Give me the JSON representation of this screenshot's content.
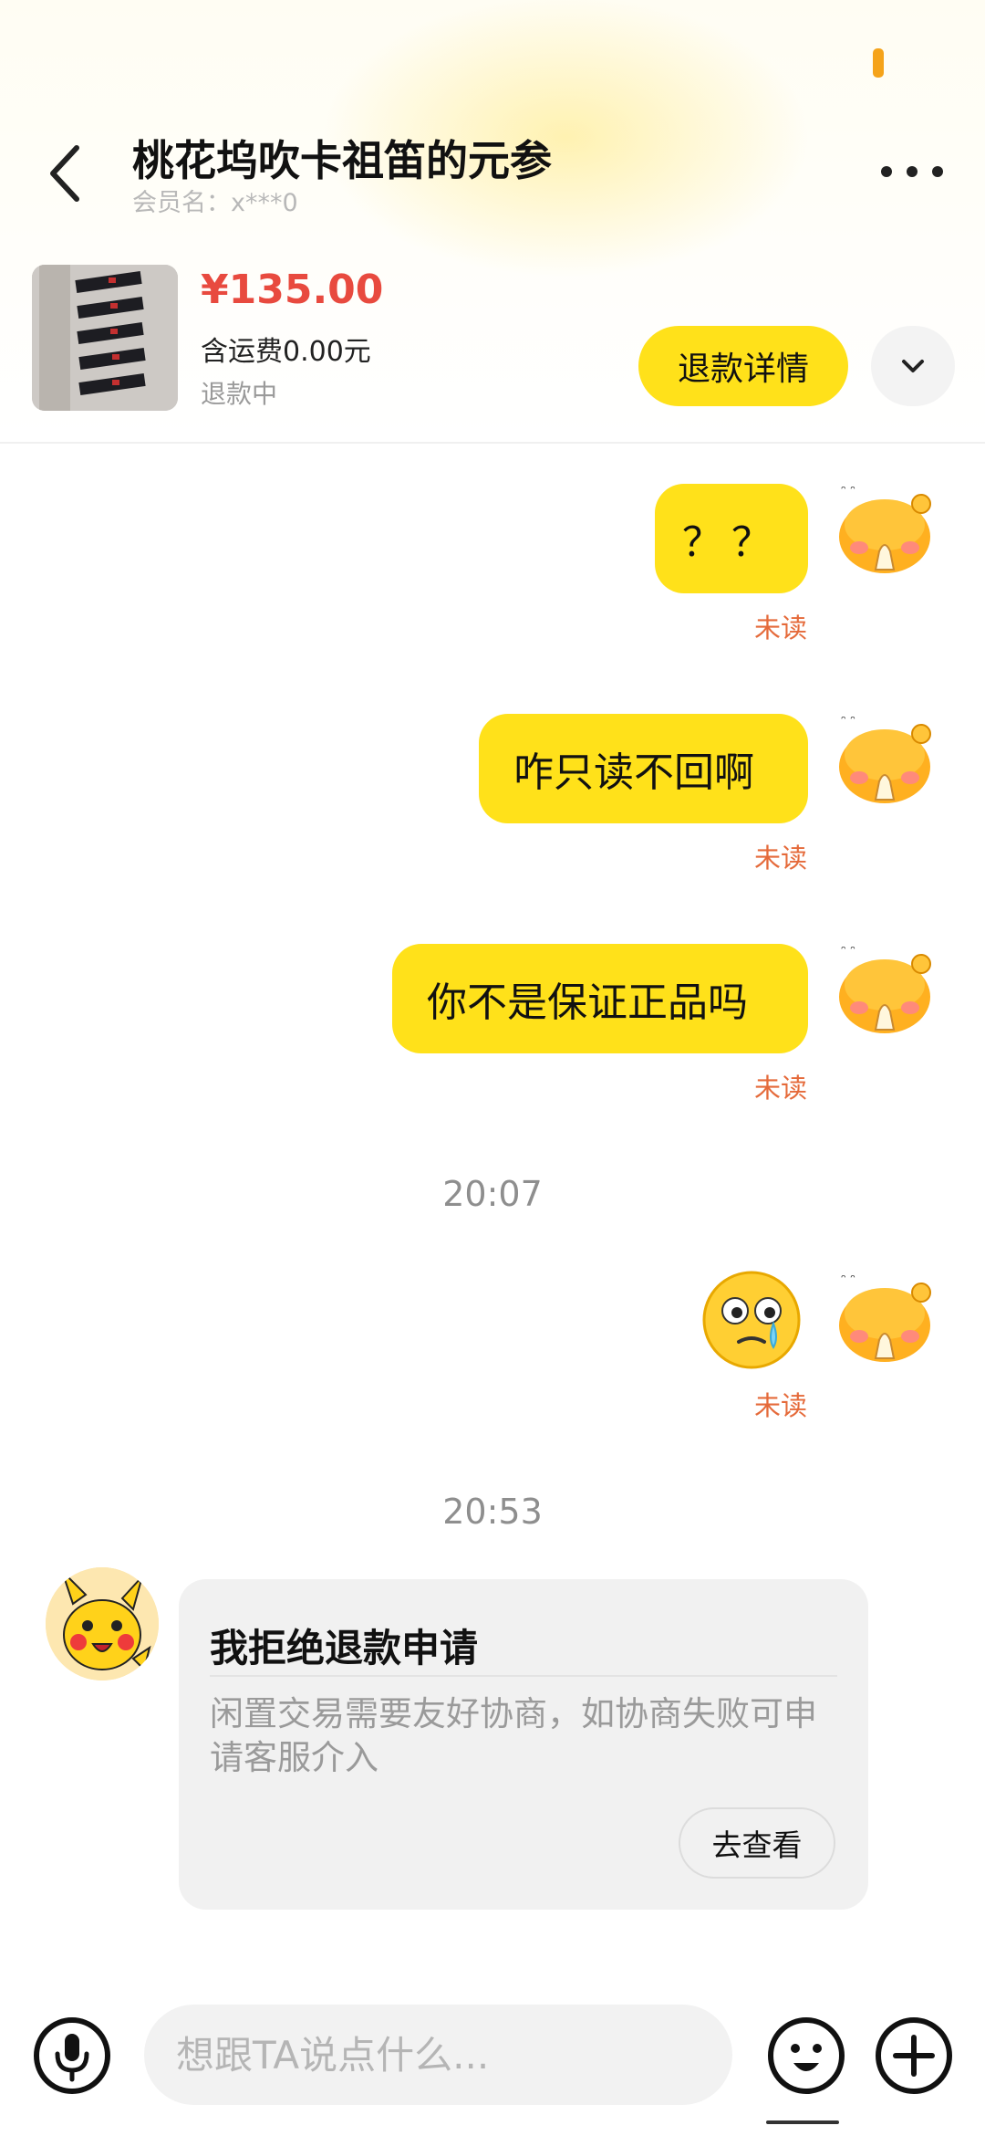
{
  "header": {
    "title": "桃花坞吹卡祖笛的元参",
    "member_label": "会员名：x***0",
    "back_icon": "chevron-left-icon",
    "more_icon": "more-horizontal-icon"
  },
  "product": {
    "price": "¥135.00",
    "shipping": "含运费0.00元",
    "status": "退款中",
    "refund_button": "退款详情",
    "expand_icon": "chevron-down-icon"
  },
  "messages": [
    {
      "text": "？？",
      "status": "未读"
    },
    {
      "text": "咋只读不回啊",
      "status": "未读"
    },
    {
      "text": "你不是保证正品吗",
      "status": "未读"
    },
    {
      "timestamp": "20:07"
    },
    {
      "emoji": "crying-face-emoji",
      "status": "未读"
    },
    {
      "timestamp": "20:53"
    }
  ],
  "refund_card": {
    "title": "我拒绝退款申请",
    "body": "闲置交易需要友好协商，如协商失败可申请客服介入",
    "button": "去查看"
  },
  "input": {
    "placeholder": "想跟TA说点什么..."
  },
  "colors": {
    "accent_yellow": "#ffe11a",
    "price_red": "#e84a3f",
    "unread_orange": "#e56a3a",
    "status_orange": "#f5a31a"
  }
}
